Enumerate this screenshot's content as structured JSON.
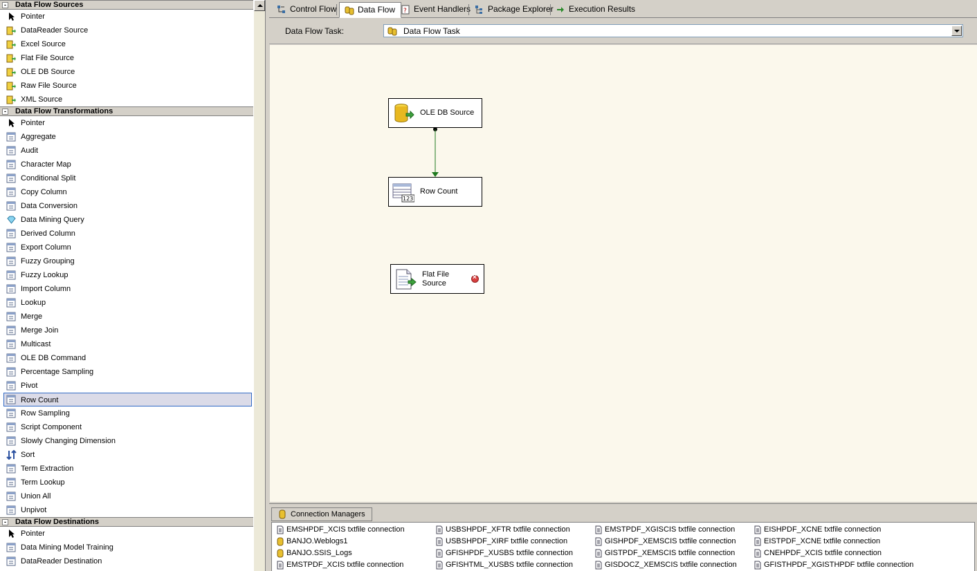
{
  "toolbox": {
    "sources": {
      "header": "Data Flow Sources",
      "items": [
        "Pointer",
        "DataReader Source",
        "Excel Source",
        "Flat File Source",
        "OLE DB Source",
        "Raw File Source",
        "XML Source"
      ]
    },
    "transformations": {
      "header": "Data Flow Transformations",
      "items": [
        "Pointer",
        "Aggregate",
        "Audit",
        "Character Map",
        "Conditional Split",
        "Copy Column",
        "Data Conversion",
        "Data Mining Query",
        "Derived Column",
        "Export Column",
        "Fuzzy Grouping",
        "Fuzzy Lookup",
        "Import Column",
        "Lookup",
        "Merge",
        "Merge Join",
        "Multicast",
        "OLE DB Command",
        "Percentage Sampling",
        "Pivot",
        "Row Count",
        "Row Sampling",
        "Script Component",
        "Slowly Changing Dimension",
        "Sort",
        "Term Extraction",
        "Term Lookup",
        "Union All",
        "Unpivot"
      ],
      "selected": "Row Count"
    },
    "destinations": {
      "header": "Data Flow Destinations",
      "items": [
        "Pointer",
        "Data Mining Model Training",
        "DataReader Destination"
      ]
    }
  },
  "tabs": [
    "Control Flow",
    "Data Flow",
    "Event Handlers",
    "Package Explorer",
    "Execution Results"
  ],
  "active_tab": "Data Flow",
  "task_row": {
    "label": "Data Flow Task:",
    "selected": "Data Flow Task"
  },
  "components": {
    "ole_db_source": "OLE DB Source",
    "row_count": "Row Count",
    "flat_file_source": "Flat File Source"
  },
  "connection_managers": {
    "tab_label": "Connection Managers",
    "columns": [
      [
        "EMSHPDF_XCIS txtfile connection",
        "BANJO.Weblogs1",
        "BANJO.SSIS_Logs",
        "EMSTPDF_XCIS txtfile connection"
      ],
      [
        "USBSHPDF_XFTR txtfile connection",
        "USBSHPDF_XIRF txtfile connection",
        "GFISHPDF_XUSBS txtfile connection",
        "GFISHTML_XUSBS  txtfile connection"
      ],
      [
        "EMSTPDF_XGISCIS txtfile connection",
        "GISHPDF_XEMSCIS txtfile connection",
        "GISTPDF_XEMSCIS txtfile connection",
        "GISDOCZ_XEMSCIS txtfile connection"
      ],
      [
        "EISHPDF_XCNE txtfile connection",
        "EISTPDF_XCNE txtfile connection",
        "CNEHPDF_XCIS txtfile connection",
        "GFISTHPDF_XGISTHPDF txtfile connection"
      ]
    ],
    "db_items": [
      "BANJO.Weblogs1",
      "BANJO.SSIS_Logs"
    ]
  }
}
